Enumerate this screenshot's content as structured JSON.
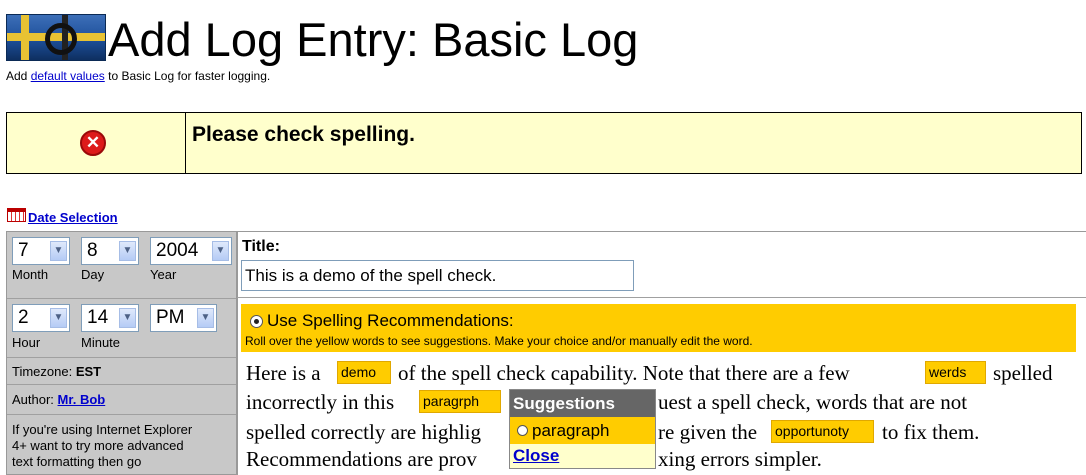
{
  "header": {
    "title": "Add Log Entry: Basic Log",
    "subtitle_prefix": "Add",
    "subtitle_link": "default values",
    "subtitle_suffix": "to Basic Log for faster logging."
  },
  "alert": {
    "icon": "error-icon",
    "message": "Please check spelling."
  },
  "date_selection": {
    "label": "Date Selection",
    "month": {
      "value": "7",
      "label": "Month"
    },
    "day": {
      "value": "8",
      "label": "Day"
    },
    "year": {
      "value": "2004",
      "label": "Year"
    },
    "hour": {
      "value": "2",
      "label": "Hour"
    },
    "minute": {
      "value": "14",
      "label": "Minute"
    },
    "ampm": {
      "value": "PM"
    },
    "timezone_label": "Timezone:",
    "timezone_value": "EST",
    "author_label": "Author:",
    "author_value": "Mr. Bob",
    "ie_note_1": "If you're using Internet Explorer",
    "ie_note_2": "4+ want to try more advanced",
    "ie_note_3": "text formatting then go"
  },
  "entry": {
    "title_label": "Title:",
    "title_value": "This is a demo of the spell check.",
    "spell_title": "Use Spelling Recommendations:",
    "spell_hint": "Roll over the yellow words to see suggestions. Make your choice and/or manually edit the word.",
    "line1_a": "Here is a",
    "line1_b": "of the spell check capability. Note that there are a few",
    "line1_c": "spelled",
    "line2_a": "incorrectly in this",
    "line2_b": "uest a spell check, words that are not",
    "line3_a": "spelled correctly are highlig",
    "line3_b": "re given the",
    "line3_c": "to fix them.",
    "line4_a": "Recommendations are prov",
    "line4_b": "xing errors simpler.",
    "words": {
      "w1": "demo",
      "w2": "werds",
      "w3": "paragrph",
      "w4": "opportunoty"
    }
  },
  "suggestions": {
    "title": "Suggestions",
    "option": "paragraph",
    "close": "Close"
  },
  "colors": {
    "highlight": "#ffcc00",
    "alert_bg": "#ffffcc",
    "popup_header": "#666666"
  }
}
